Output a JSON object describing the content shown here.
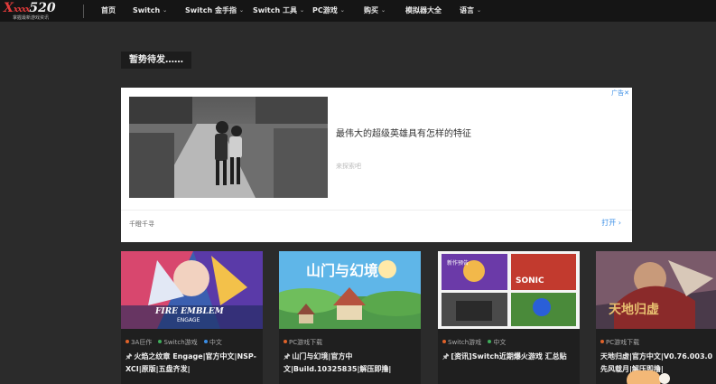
{
  "header": {
    "logo": {
      "x_letter": "X",
      "number": "520",
      "tagline": "掌握最新游戏资讯"
    },
    "nav": [
      {
        "label": "首页",
        "dropdown": false
      },
      {
        "label": "Switch",
        "dropdown": true
      },
      {
        "label": "Switch 金手指",
        "dropdown": true
      },
      {
        "label": "Switch 工具",
        "dropdown": true
      },
      {
        "label": "PC游戏",
        "dropdown": true
      },
      {
        "label": "购买",
        "dropdown": true
      },
      {
        "label": "模拟器大全",
        "dropdown": false
      },
      {
        "label": "语言",
        "dropdown": true
      }
    ],
    "caret_glyph": "⌄"
  },
  "notice": {
    "text": "暂势待发……"
  },
  "ad": {
    "corner_label": "广告✕",
    "headline": "最伟大的超级英雄具有怎样的特征",
    "source": "来探索吧",
    "brand": "千瞪千寻",
    "open_label": "打开 ›",
    "accent": "#3a8ee6"
  },
  "cards": [
    {
      "tags": [
        {
          "label": "3A巨作",
          "color": "#e0622a"
        },
        {
          "label": "Switch游戏",
          "color": "#3fae5b"
        },
        {
          "label": "中文",
          "color": "#3a8ee6"
        }
      ],
      "title": "火焰之纹章 Engage|官方中文|NSP-XCI|原版|五盘齐发|",
      "art_text": "FIRE EMBLEM",
      "art_sub": "ENGAGE"
    },
    {
      "tags": [
        {
          "label": "PC游戏下载",
          "color": "#e0622a"
        }
      ],
      "title": "山门与幻境|官方中文|Build.10325835|解压即撸|",
      "art_text": "山门与幻境"
    },
    {
      "tags": [
        {
          "label": "Switch游戏",
          "color": "#e0622a"
        },
        {
          "label": "中文",
          "color": "#3fae5b"
        }
      ],
      "title": "[资讯]Switch近期爆火游戏 汇总贴",
      "art_text": "SONIC",
      "art_sub": "新作预告"
    },
    {
      "tags": [
        {
          "label": "PC游戏下载",
          "color": "#e0622a"
        }
      ],
      "title": "天地归虚|官方中文|V0.76.003.0先风载月|解压即撸|",
      "art_text": "天地归虚"
    }
  ],
  "pin_glyph": "🖈"
}
